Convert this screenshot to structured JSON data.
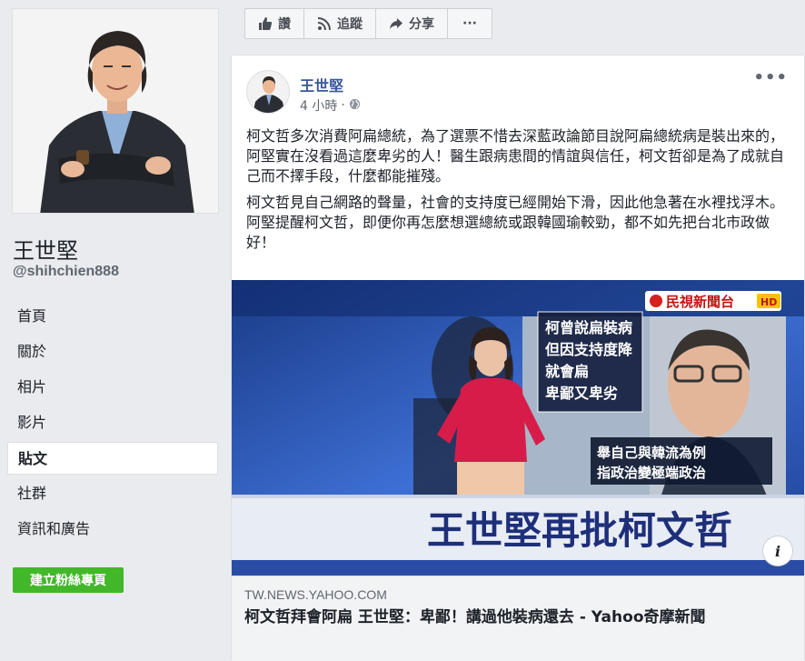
{
  "profile": {
    "name": "王世堅",
    "handle": "@shihchien888"
  },
  "nav": {
    "items": [
      {
        "label": "首頁"
      },
      {
        "label": "關於"
      },
      {
        "label": "相片"
      },
      {
        "label": "影片"
      },
      {
        "label": "貼文",
        "active": true
      },
      {
        "label": "社群"
      },
      {
        "label": "資訊和廣告"
      }
    ],
    "create_page_label": "建立粉絲專頁"
  },
  "action_bar": {
    "like_label": "讚",
    "follow_label": "追蹤",
    "share_label": "分享",
    "more_label": "···"
  },
  "post": {
    "author": "王世堅",
    "time": "4 小時",
    "more_label": "•••",
    "paragraphs": [
      "柯文哲多次消費阿扁總統，為了選票不惜去深藍政論節目說阿扁總統病是裝出來的，阿堅實在沒看過這麼卑劣的人！醫生跟病患間的情誼與信任，柯文哲卻是為了成就自己而不擇手段，什麼都能摧殘。",
      "柯文哲見自己網路的聲量，社會的支持度已經開始下滑，因此他急著在水裡找浮木。阿堅提醒柯文哲，即便你再怎麼想選總統或跟韓國瑜較勁，都不如先把台北市政做好！"
    ]
  },
  "link_preview": {
    "image": {
      "channel": "民視新聞台",
      "hd": "HD",
      "caption_box": [
        "柯曾說扁裝病",
        "但因支持度降",
        "就會扁",
        "卑鄙又卑劣"
      ],
      "sub_caption": [
        "舉自己與韓流為例",
        "指政治變極端政治"
      ],
      "headline": "王世堅再批柯文哲"
    },
    "info_label": "i",
    "domain": "TW.NEWS.YAHOO.COM",
    "title": "柯文哲拜會阿扁 王世堅：卑鄙！講過他裝病還去 - Yahoo奇摩新聞"
  },
  "colors": {
    "link_blue": "#385898",
    "green": "#42b72a",
    "bg": "#e9ebee"
  }
}
